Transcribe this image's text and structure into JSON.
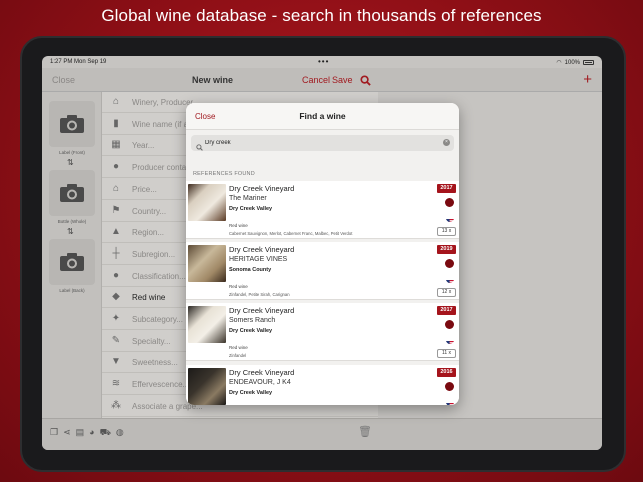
{
  "headline": "Global wine database - search in thousands of references",
  "status": {
    "time": "1:27 PM  Mon Sep 19",
    "dots": "•••",
    "battery": "100%"
  },
  "nav": {
    "close": "Close",
    "title": "New wine",
    "cancel": "Cancel",
    "save": "Save"
  },
  "photos": [
    {
      "label": "Label (Front)"
    },
    {
      "label": "Bottle (Whole)"
    },
    {
      "label": "Label (Back)"
    }
  ],
  "form": [
    {
      "icon": "house-icon",
      "glyph": "⌂",
      "text": "Winery, Producer...",
      "dark": false
    },
    {
      "icon": "bottle-icon",
      "glyph": "▮",
      "text": "Wine name (if any)",
      "dark": false
    },
    {
      "icon": "calendar-icon",
      "glyph": "▦",
      "text": "Year...",
      "dark": false
    },
    {
      "icon": "person-icon",
      "glyph": "●",
      "text": "Producer contact",
      "dark": false
    },
    {
      "icon": "bank-icon",
      "glyph": "⌂",
      "text": "Price...",
      "dark": false
    },
    {
      "icon": "flag-icon",
      "glyph": "⚑",
      "text": "Country...",
      "dark": false
    },
    {
      "icon": "map-icon",
      "glyph": "▲",
      "text": "Region...",
      "dark": false
    },
    {
      "icon": "signpost-icon",
      "glyph": "┼",
      "text": "Subregion...",
      "dark": false
    },
    {
      "icon": "pin-icon",
      "glyph": "●",
      "text": "Classification...",
      "dark": false
    },
    {
      "icon": "tag-icon",
      "glyph": "◆",
      "text": "Red wine",
      "dark": true
    },
    {
      "icon": "pushpin-icon",
      "glyph": "✦",
      "text": "Subcategory...",
      "dark": false
    },
    {
      "icon": "brush-icon",
      "glyph": "✎",
      "text": "Specialty...",
      "dark": false
    },
    {
      "icon": "flask-icon",
      "glyph": "▼",
      "text": "Sweetness...",
      "dark": false
    },
    {
      "icon": "bubbles-icon",
      "glyph": "≋",
      "text": "Effervescence...",
      "dark": false
    },
    {
      "icon": "grape-icon",
      "glyph": "⁂",
      "text": "Associate a grape...",
      "dark": false
    }
  ],
  "modal": {
    "close": "Close",
    "title": "Find a wine",
    "search_value": "Dry creek",
    "section": "REFERENCES FOUND",
    "results": [
      {
        "producer": "Dry Creek Vineyard",
        "name": "The Mariner",
        "region": "Dry Creek Valley",
        "color": "Red wine",
        "grapes": "Cabernet Sauvignon, Merlot, Cabernet Franc, Malbec, Petit Verdot",
        "vintage": "2017",
        "count": "13 x"
      },
      {
        "producer": "Dry Creek Vineyard",
        "name": "HERITAGE VINES",
        "region": "Sonoma County",
        "color": "Red wine",
        "grapes": "Zinfandel, Petite Sirah, Carignan",
        "vintage": "2019",
        "count": "12 x"
      },
      {
        "producer": "Dry Creek Vineyard",
        "name": "Somers Ranch",
        "region": "Dry Creek Valley",
        "color": "Red wine",
        "grapes": "Zinfandel",
        "vintage": "2017",
        "count": "11 x"
      },
      {
        "producer": "Dry Creek Vineyard",
        "name": "ENDEAVOUR, J K4",
        "region": "Dry Creek Valley",
        "color": "",
        "grapes": "",
        "vintage": "2016",
        "count": ""
      }
    ]
  },
  "colors": {
    "accent": "#a11a20",
    "background": "#9a1219",
    "wine_dot": "#7a0a10"
  }
}
